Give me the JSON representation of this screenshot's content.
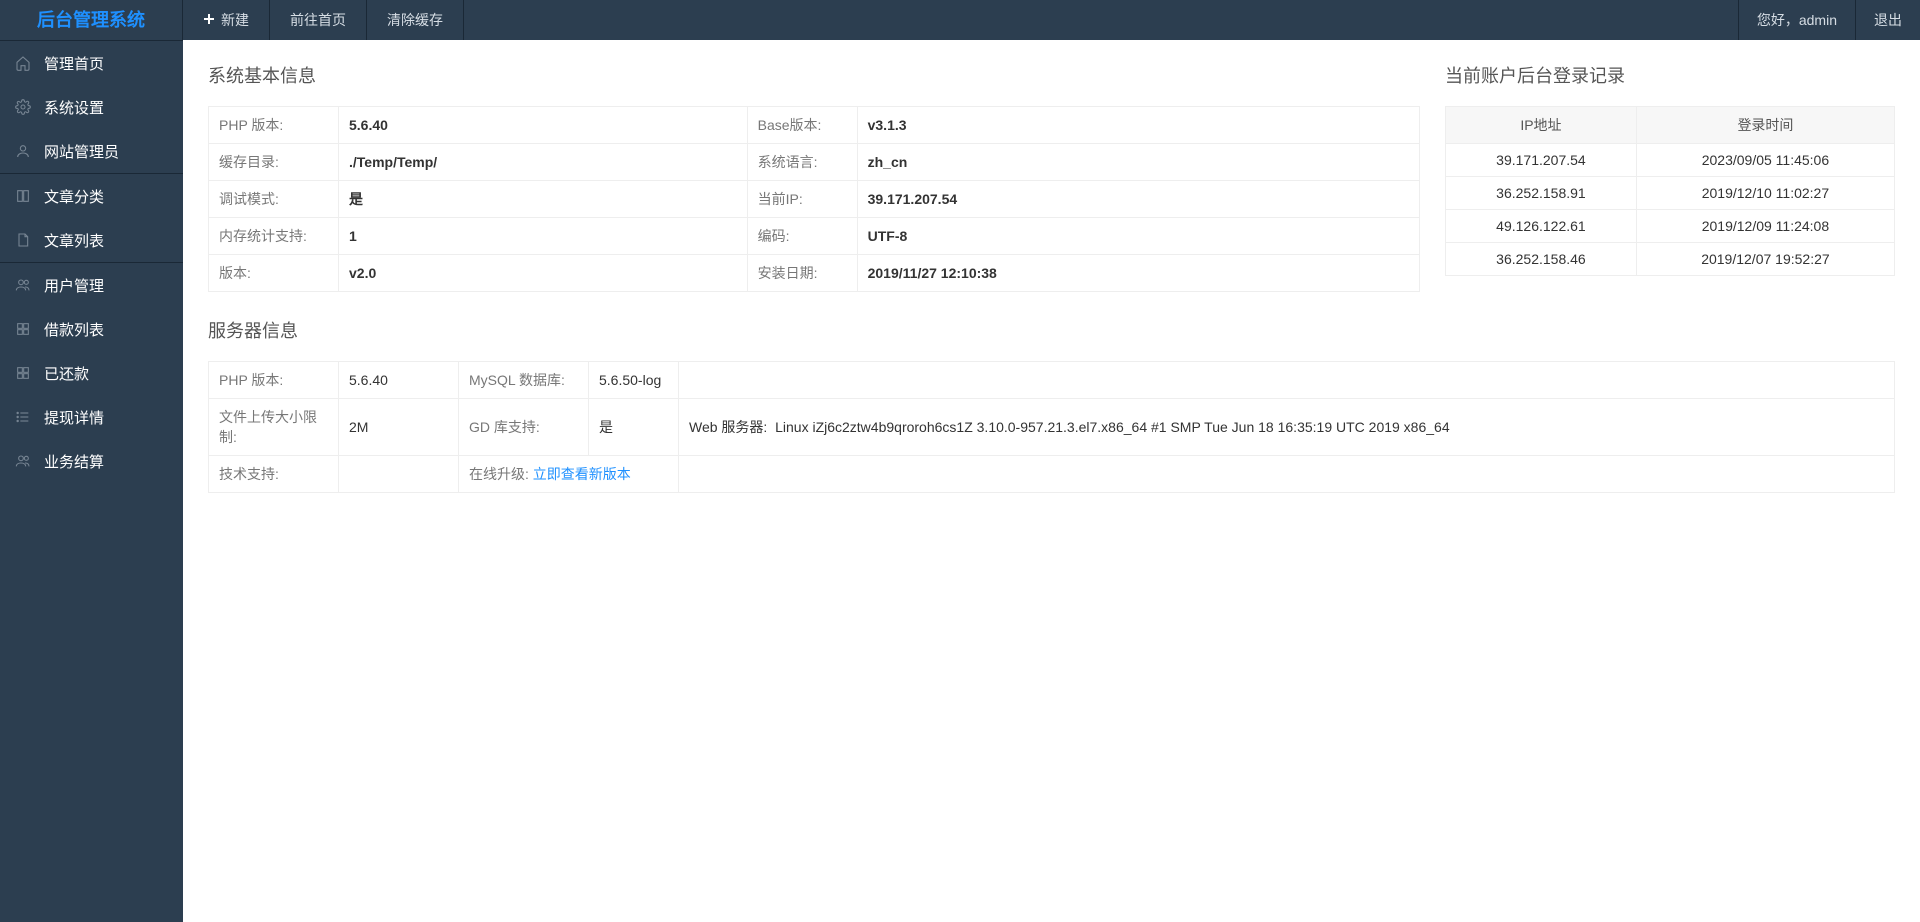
{
  "header": {
    "logo": "后台管理系统",
    "nav": {
      "new": "新建",
      "home": "前往首页",
      "clear": "清除缓存"
    },
    "greeting": "您好，admin",
    "logout": "退出"
  },
  "sidebar": {
    "g1": [
      {
        "id": "dashboard",
        "label": "管理首页",
        "icon": "home"
      },
      {
        "id": "settings",
        "label": "系统设置",
        "icon": "gear"
      },
      {
        "id": "admins",
        "label": "网站管理员",
        "icon": "user"
      }
    ],
    "g2": [
      {
        "id": "categories",
        "label": "文章分类",
        "icon": "book"
      },
      {
        "id": "articles",
        "label": "文章列表",
        "icon": "file"
      }
    ],
    "g3": [
      {
        "id": "users",
        "label": "用户管理",
        "icon": "users"
      },
      {
        "id": "loans",
        "label": "借款列表",
        "icon": "grid"
      },
      {
        "id": "repaid",
        "label": "已还款",
        "icon": "grid"
      },
      {
        "id": "withdraw",
        "label": "提现详情",
        "icon": "list"
      },
      {
        "id": "settle",
        "label": "业务结算",
        "icon": "users"
      }
    ]
  },
  "sections": {
    "sysinfo": "系统基本信息",
    "loginlog": "当前账户后台登录记录",
    "serverinfo": "服务器信息"
  },
  "sysinfo": {
    "rows": [
      {
        "l1": "PHP 版本:",
        "v1": "5.6.40",
        "l2": "Base版本:",
        "v2": "v3.1.3"
      },
      {
        "l1": "缓存目录:",
        "v1": "./Temp/Temp/",
        "l2": "系统语言:",
        "v2": "zh_cn"
      },
      {
        "l1": "调试模式:",
        "v1": "是",
        "l2": "当前IP:",
        "v2": "39.171.207.54"
      },
      {
        "l1": "内存统计支持:",
        "v1": "1",
        "l2": "编码:",
        "v2": "UTF-8"
      },
      {
        "l1": "版本:",
        "v1": "v2.0",
        "l2": "安装日期:",
        "v2": "2019/11/27 12:10:38"
      }
    ]
  },
  "loginlog": {
    "headers": {
      "ip": "IP地址",
      "time": "登录时间"
    },
    "rows": [
      {
        "ip": "39.171.207.54",
        "time": "2023/09/05 11:45:06"
      },
      {
        "ip": "36.252.158.91",
        "time": "2019/12/10 11:02:27"
      },
      {
        "ip": "49.126.122.61",
        "time": "2019/12/09 11:24:08"
      },
      {
        "ip": "36.252.158.46",
        "time": "2019/12/07 19:52:27"
      }
    ]
  },
  "serverinfo": {
    "r1": {
      "l1": "PHP 版本:",
      "v1": "5.6.40",
      "l2": "MySQL 数据库:",
      "v2": "5.6.50-log",
      "l3": "",
      "v3": ""
    },
    "r2": {
      "l1": "文件上传大小限制:",
      "v1": "2M",
      "l2": "GD 库支持:",
      "v2": "是",
      "l3": "Web 服务器:",
      "v3": "Linux iZj6c2ztw4b9qroroh6cs1Z 3.10.0-957.21.3.el7.x86_64 #1 SMP Tue Jun 18 16:35:19 UTC 2019 x86_64"
    },
    "r3": {
      "l1": "技术支持:",
      "v1": "",
      "l2pre": "在线升级: ",
      "l2link": "立即查看新版本",
      "l3": "",
      "v3": ""
    }
  }
}
